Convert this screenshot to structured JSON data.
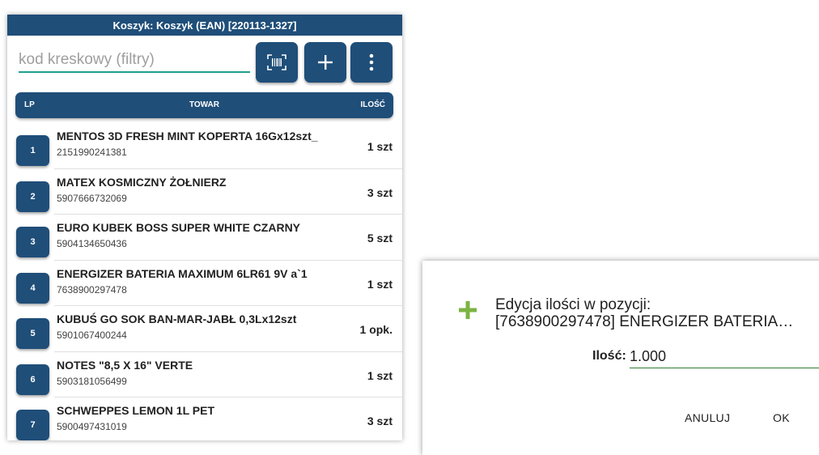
{
  "app": {
    "title": "Koszyk: Koszyk (EAN) [220113-1327]",
    "search": {
      "placeholder": "kod kreskowy (filtry)",
      "value": ""
    }
  },
  "table": {
    "headers": {
      "lp": "LP",
      "towar": "TOWAR",
      "ilosc": "ILOŚĆ"
    },
    "rows": [
      {
        "lp": "1",
        "name": "MENTOS 3D FRESH MINT KOPERTA 16Gx12szt_",
        "ean": "2151990241381",
        "qty": "1 szt"
      },
      {
        "lp": "2",
        "name": "MATEX KOSMICZNY ŻOŁNIERZ",
        "ean": "5907666732069",
        "qty": "3 szt"
      },
      {
        "lp": "3",
        "name": "EURO KUBEK BOSS SUPER WHITE CZARNY",
        "ean": "5904134650436",
        "qty": "5 szt"
      },
      {
        "lp": "4",
        "name": "ENERGIZER BATERIA MAXIMUM 6LR61 9V a`1",
        "ean": "7638900297478",
        "qty": "1 szt"
      },
      {
        "lp": "5",
        "name": "KUBUŚ GO SOK BAN-MAR-JABŁ  0,3Lx12szt",
        "ean": "5901067400244",
        "qty": "1 opk."
      },
      {
        "lp": "6",
        "name": "NOTES \"8,5 X 16\" VERTE",
        "ean": "5903181056499",
        "qty": "1 szt"
      },
      {
        "lp": "7",
        "name": "SCHWEPPES LEMON 1L PET",
        "ean": "5900497431019",
        "qty": "3 szt"
      }
    ]
  },
  "dialog": {
    "title_line1": "Edycja ilości w pozycji:",
    "title_line2": "[7638900297478] ENERGIZER BATERIA…",
    "qty_label": "Ilość:",
    "qty_value": "1.000",
    "cancel_label": "ANULUJ",
    "ok_label": "OK"
  },
  "colors": {
    "primary": "#1f4e79",
    "input_accent": "#1f9e8f",
    "plus_icon": "#7cb342"
  },
  "icons": {
    "scan": "barcode-scan-icon",
    "add": "plus-icon",
    "more": "more-vertical-icon",
    "dialog": "plus-icon"
  }
}
